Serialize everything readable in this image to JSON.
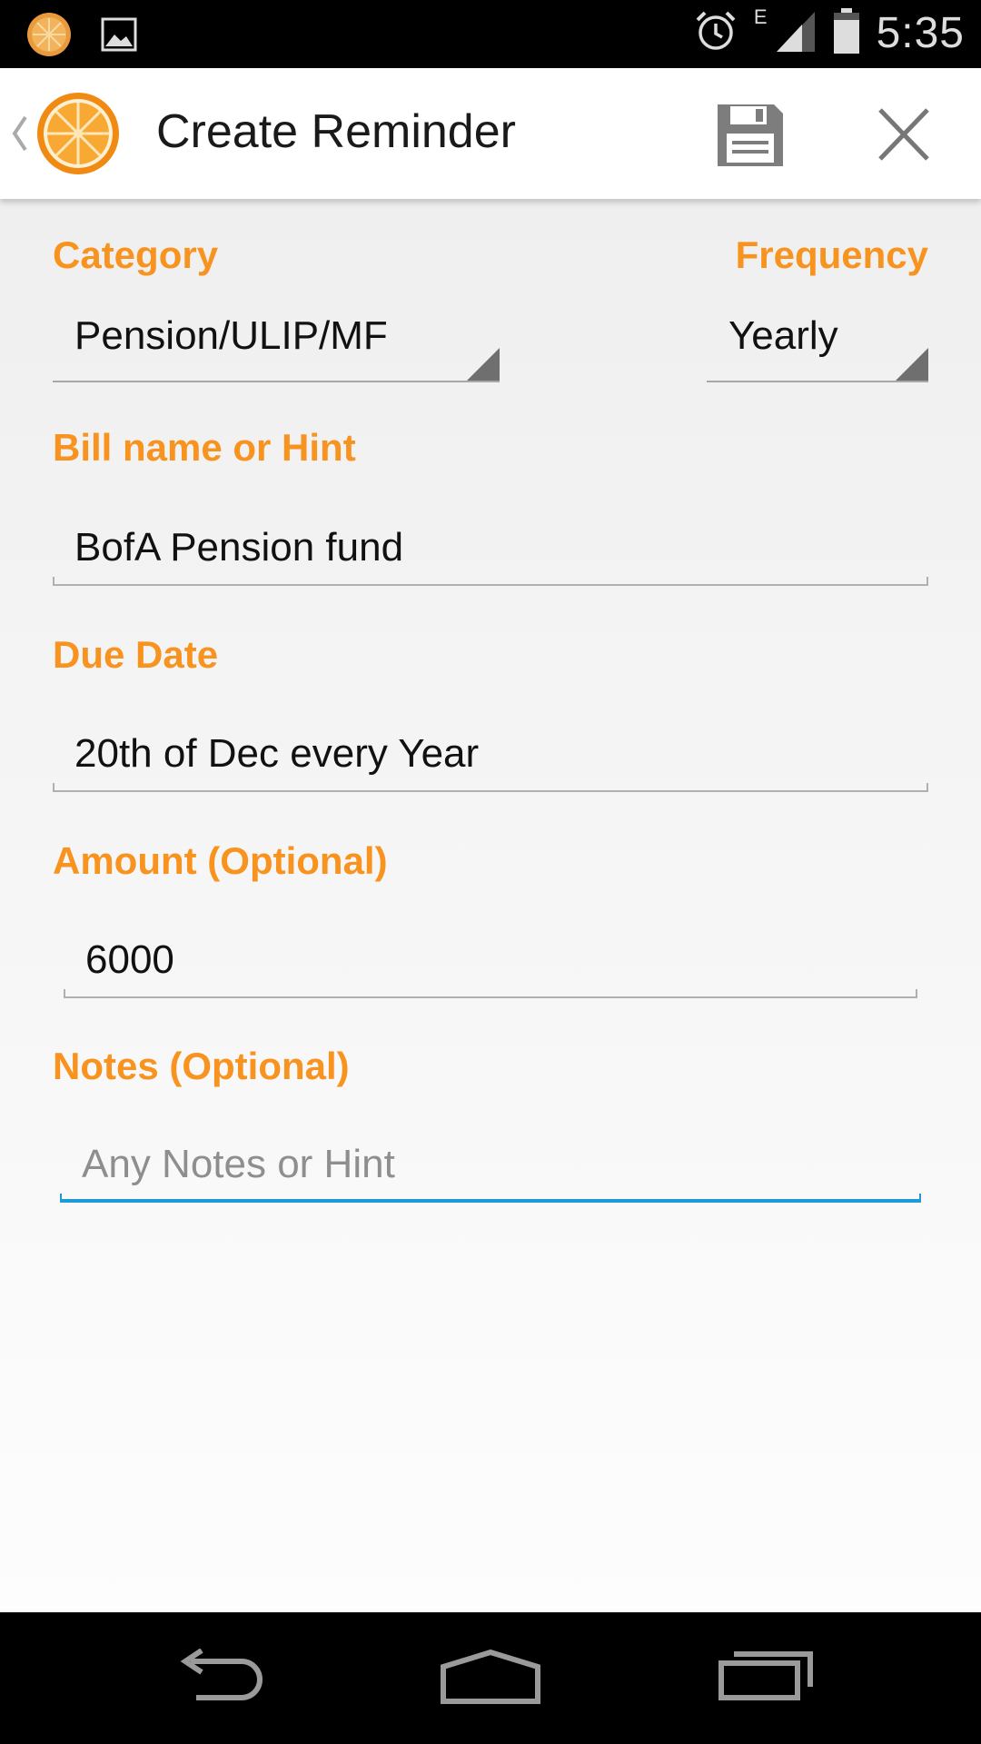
{
  "status_bar": {
    "time": "5:35",
    "network": "E",
    "left_icons": [
      "orange-app-notification-icon",
      "image-notification-icon"
    ],
    "right_icons": [
      "alarm-icon",
      "signal-icon",
      "battery-icon"
    ]
  },
  "action_bar": {
    "title": "Create Reminder",
    "icons": [
      "up-caret-icon",
      "orange-logo-icon",
      "save-icon",
      "close-icon"
    ]
  },
  "form": {
    "category_label": "Category",
    "category_value": "Pension/ULIP/MF",
    "frequency_label": "Frequency",
    "frequency_value": "Yearly",
    "bill_label": "Bill name or Hint",
    "bill_value": "BofA Pension fund",
    "due_label": "Due Date",
    "due_value": "20th of Dec every Year",
    "amount_label": "Amount (Optional)",
    "amount_value": "6000",
    "notes_label": "Notes (Optional)",
    "notes_value": "",
    "notes_placeholder": "Any Notes or Hint"
  },
  "nav_bar": {
    "icons": [
      "back-icon",
      "home-icon",
      "recent-apps-icon"
    ]
  },
  "colors": {
    "accent_orange": "#f7931e",
    "focus_blue": "#1e9ad6",
    "title_text": "#1a1a1a"
  }
}
